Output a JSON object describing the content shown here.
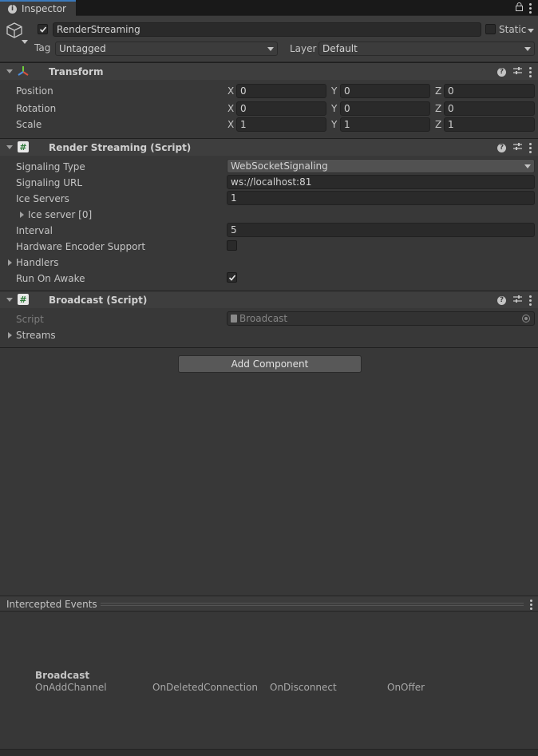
{
  "tab": {
    "label": "Inspector"
  },
  "header": {
    "object_name": "RenderStreaming",
    "static_label": "Static",
    "tag_label": "Tag",
    "tag_value": "Untagged",
    "layer_label": "Layer",
    "layer_value": "Default"
  },
  "transform": {
    "title": "Transform",
    "rows": [
      {
        "label": "Position",
        "x": "0",
        "y": "0",
        "z": "0"
      },
      {
        "label": "Rotation",
        "x": "0",
        "y": "0",
        "z": "0"
      },
      {
        "label": "Scale",
        "x": "1",
        "y": "1",
        "z": "1"
      }
    ],
    "axes": {
      "x": "X",
      "y": "Y",
      "z": "Z"
    }
  },
  "render_streaming": {
    "title": "Render Streaming (Script)",
    "signaling_type_label": "Signaling Type",
    "signaling_type_value": "WebSocketSignaling",
    "signaling_url_label": "Signaling URL",
    "signaling_url_value": "ws://localhost:81",
    "ice_servers_label": "Ice Servers",
    "ice_servers_value": "1",
    "ice_server_item": "Ice server [0]",
    "interval_label": "Interval",
    "interval_value": "5",
    "hw_encoder_label": "Hardware Encoder Support",
    "hw_encoder_checked": false,
    "handlers_label": "Handlers",
    "run_on_awake_label": "Run On Awake",
    "run_on_awake_checked": true
  },
  "broadcast": {
    "title": "Broadcast (Script)",
    "script_label": "Script",
    "script_value": "Broadcast",
    "streams_label": "Streams"
  },
  "add_component_label": "Add Component",
  "intercepted_events": {
    "title": "Intercepted Events",
    "group_name": "Broadcast",
    "events": [
      "OnAddChannel",
      "OnDeletedConnection",
      "OnDisconnect",
      "OnOffer"
    ]
  },
  "colors": {
    "background": "#383838",
    "tab_accent": "#3a79bb",
    "field_bg": "#2a2a2a"
  }
}
